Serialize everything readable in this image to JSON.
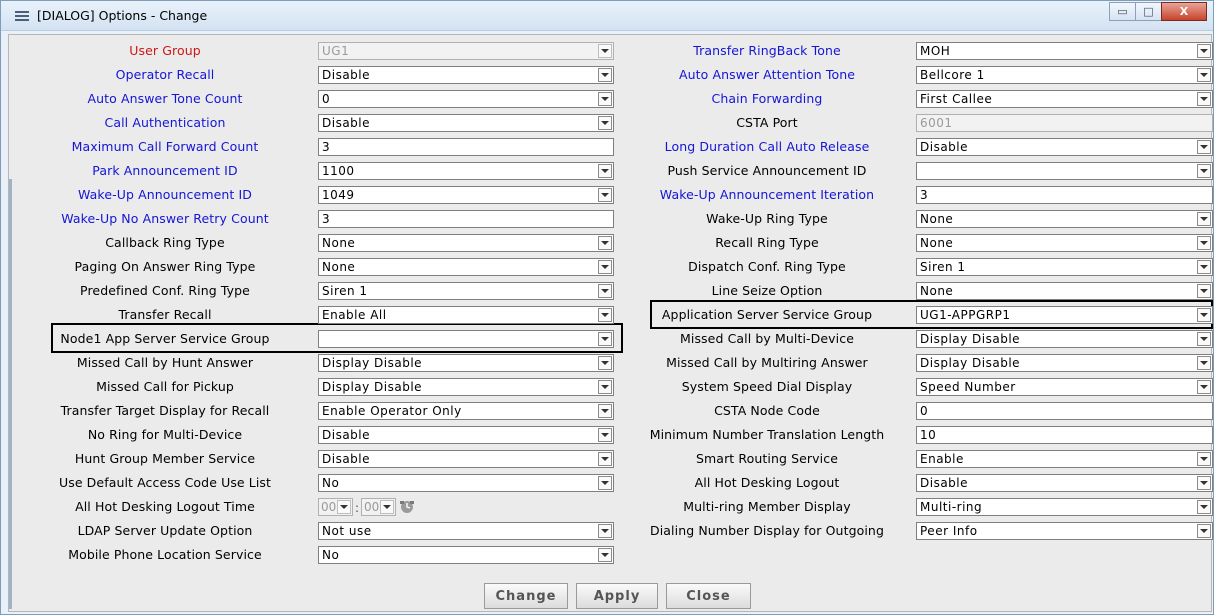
{
  "window": {
    "title": "[DIALOG] Options - Change",
    "controls": {
      "minimize": "▭",
      "maximize": "□",
      "close": "X"
    }
  },
  "left": [
    {
      "label": "User Group",
      "color": "red",
      "type": "select",
      "value": "UG1",
      "disabled": true
    },
    {
      "label": "Operator Recall",
      "color": "blue",
      "type": "select",
      "value": "Disable"
    },
    {
      "label": "Auto Answer Tone Count",
      "color": "blue",
      "type": "select",
      "value": "0"
    },
    {
      "label": "Call Authentication",
      "color": "blue",
      "type": "select",
      "value": "Disable"
    },
    {
      "label": "Maximum Call Forward Count",
      "color": "blue",
      "type": "text",
      "value": "3"
    },
    {
      "label": "Park Announcement ID",
      "color": "blue",
      "type": "select",
      "value": "1100"
    },
    {
      "label": "Wake-Up Announcement ID",
      "color": "blue",
      "type": "select",
      "value": "1049"
    },
    {
      "label": "Wake-Up No Answer Retry Count",
      "color": "blue",
      "type": "text",
      "value": "3"
    },
    {
      "label": "Callback Ring Type",
      "color": "black",
      "type": "select",
      "value": "None"
    },
    {
      "label": "Paging On Answer Ring Type",
      "color": "black",
      "type": "select",
      "value": "None"
    },
    {
      "label": "Predefined Conf. Ring Type",
      "color": "black",
      "type": "select",
      "value": "Siren 1"
    },
    {
      "label": "Transfer Recall",
      "color": "black",
      "type": "select",
      "value": "Enable All"
    },
    {
      "label": "Node1 App Server Service Group",
      "color": "black",
      "type": "select",
      "value": ""
    },
    {
      "label": "Missed Call by Hunt Answer",
      "color": "black",
      "type": "select",
      "value": "Display Disable"
    },
    {
      "label": "Missed Call for Pickup",
      "color": "black",
      "type": "select",
      "value": "Display Disable"
    },
    {
      "label": "Transfer Target Display for Recall",
      "color": "black",
      "type": "select",
      "value": "Enable Operator Only"
    },
    {
      "label": "No Ring for Multi-Device",
      "color": "black",
      "type": "select",
      "value": "Disable"
    },
    {
      "label": "Hunt Group Member Service",
      "color": "black",
      "type": "select",
      "value": "Disable"
    },
    {
      "label": "Use Default Access Code Use List",
      "color": "black",
      "type": "select",
      "value": "No"
    },
    {
      "label": "All Hot Desking Logout Time",
      "color": "black",
      "type": "time",
      "hour": "00",
      "minute": "00"
    },
    {
      "label": "LDAP Server Update Option",
      "color": "black",
      "type": "select",
      "value": "Not use"
    },
    {
      "label": "Mobile Phone Location Service",
      "color": "black",
      "type": "select",
      "value": "No"
    }
  ],
  "right": [
    {
      "label": "Transfer RingBack Tone",
      "color": "blue",
      "type": "select",
      "value": "MOH"
    },
    {
      "label": "Auto Answer Attention Tone",
      "color": "blue",
      "type": "select",
      "value": "Bellcore 1"
    },
    {
      "label": "Chain Forwarding",
      "color": "blue",
      "type": "select",
      "value": "First Callee"
    },
    {
      "label": "CSTA Port",
      "color": "black",
      "type": "text",
      "value": "6001",
      "disabled": true
    },
    {
      "label": "Long Duration Call Auto Release",
      "color": "blue",
      "type": "select",
      "value": "Disable"
    },
    {
      "label": "Push Service Announcement ID",
      "color": "black",
      "type": "select",
      "value": ""
    },
    {
      "label": "Wake-Up Announcement Iteration",
      "color": "blue",
      "type": "text",
      "value": "3"
    },
    {
      "label": "Wake-Up Ring Type",
      "color": "black",
      "type": "select",
      "value": "None"
    },
    {
      "label": "Recall Ring Type",
      "color": "black",
      "type": "select",
      "value": "None"
    },
    {
      "label": "Dispatch Conf. Ring Type",
      "color": "black",
      "type": "select",
      "value": "Siren 1"
    },
    {
      "label": "Line Seize Option",
      "color": "black",
      "type": "select",
      "value": "None"
    },
    {
      "label": "Application Server Service Group",
      "color": "black",
      "type": "select",
      "value": "UG1-APPGRP1"
    },
    {
      "label": "Missed Call by Multi-Device",
      "color": "black",
      "type": "select",
      "value": "Display Disable"
    },
    {
      "label": "Missed Call by Multiring Answer",
      "color": "black",
      "type": "select",
      "value": "Display Disable"
    },
    {
      "label": "System Speed Dial Display",
      "color": "black",
      "type": "select",
      "value": "Speed Number"
    },
    {
      "label": "CSTA Node Code",
      "color": "black",
      "type": "text",
      "value": "0"
    },
    {
      "label": "Minimum Number Translation Length",
      "color": "black",
      "type": "text",
      "value": "10"
    },
    {
      "label": "Smart Routing Service",
      "color": "black",
      "type": "select",
      "value": "Enable"
    },
    {
      "label": "All Hot Desking Logout",
      "color": "black",
      "type": "select",
      "value": "Disable"
    },
    {
      "label": "Multi-ring Member Display",
      "color": "black",
      "type": "select",
      "value": "Multi-ring"
    },
    {
      "label": "Dialing Number Display for Outgoing",
      "color": "black",
      "type": "select",
      "value": "Peer Info"
    }
  ],
  "buttons": {
    "change": "Change",
    "apply": "Apply",
    "close": "Close"
  },
  "colors": {
    "blue_label": "#1515d6",
    "red_label": "#d01515",
    "panel": "#ebebeb"
  }
}
